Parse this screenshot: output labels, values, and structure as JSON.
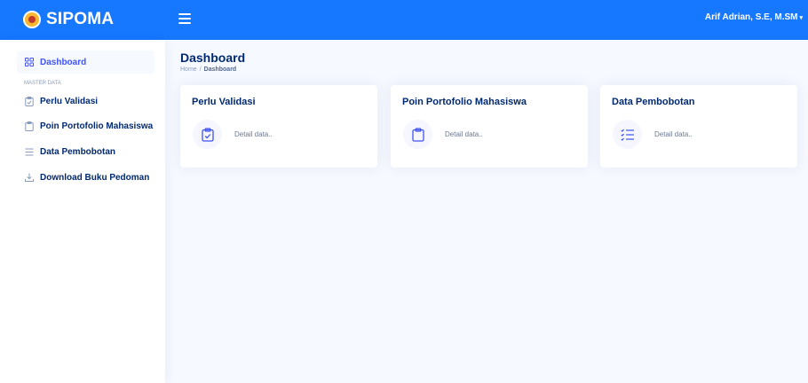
{
  "header": {
    "brand": "SIPOMA",
    "user_name": "Arif Adrian, S.E, M.SM",
    "caret": "▾"
  },
  "sidebar": {
    "items": [
      {
        "label": "Dashboard",
        "icon": "grid-icon"
      },
      {
        "label": "Perlu Validasi",
        "icon": "clipboard-check-icon"
      },
      {
        "label": "Poin Portofolio Mahasiswa",
        "icon": "clipboard-icon"
      },
      {
        "label": "Data Pembobotan",
        "icon": "list-icon"
      },
      {
        "label": "Download Buku Pedoman",
        "icon": "download-icon"
      }
    ],
    "heading": "MASTER DATA"
  },
  "page": {
    "title": "Dashboard",
    "breadcrumb": [
      "Home",
      "Dashboard"
    ],
    "breadcrumb_sep": "/"
  },
  "cards": [
    {
      "title": "Perlu Validasi",
      "detail": "Detail data..",
      "icon": "clipboard-check-icon"
    },
    {
      "title": "Poin Portofolio Mahasiswa",
      "detail": "Detail data..",
      "icon": "clipboard-icon"
    },
    {
      "title": "Data Pembobotan",
      "detail": "Detail data..",
      "icon": "list-icon"
    }
  ],
  "colors": {
    "topbar": "#1677ff",
    "accent": "#4154f1",
    "text_dark": "#012970",
    "muted": "#899bbd",
    "background": "#f6f9ff"
  }
}
